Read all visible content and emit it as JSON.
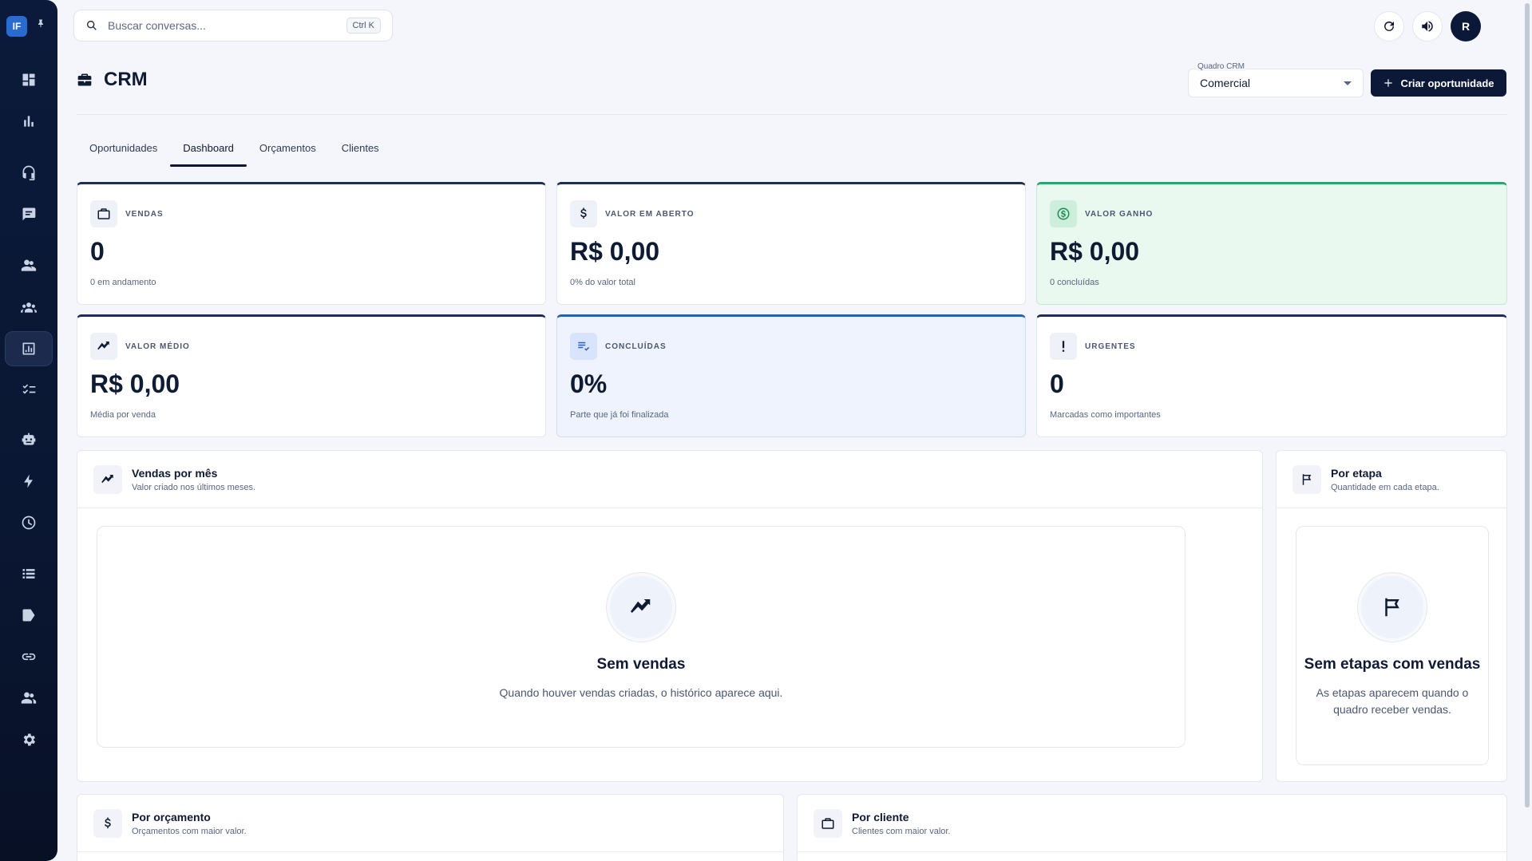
{
  "sidebar": {
    "logo_text": "IF",
    "items": [
      {
        "name": "dashboard-icon"
      },
      {
        "name": "bar-chart-icon"
      },
      {
        "name": "headset-icon"
      },
      {
        "name": "chat-icon"
      },
      {
        "name": "people-icon"
      },
      {
        "name": "groups-icon"
      },
      {
        "name": "analytics-icon",
        "active": true
      },
      {
        "name": "checklist-icon"
      },
      {
        "name": "robot-icon"
      },
      {
        "name": "bolt-icon"
      },
      {
        "name": "clock-icon"
      },
      {
        "name": "list-icon"
      },
      {
        "name": "tag-icon"
      },
      {
        "name": "link-icon"
      },
      {
        "name": "contacts-icon"
      },
      {
        "name": "settings-icon"
      }
    ]
  },
  "search": {
    "placeholder": "Buscar conversas...",
    "shortcut": "Ctrl K"
  },
  "header": {
    "avatar_initial": "R",
    "title": "CRM",
    "board_label": "Quadro CRM",
    "board_value": "Comercial",
    "create_label": "Criar oportunidade"
  },
  "tabs": [
    {
      "label": "Oportunidades"
    },
    {
      "label": "Dashboard",
      "active": true
    },
    {
      "label": "Orçamentos"
    },
    {
      "label": "Clientes"
    }
  ],
  "stats": [
    {
      "label": "VENDAS",
      "value": "0",
      "sub": "0 em andamento",
      "icon": "briefcase-icon",
      "variant": "default"
    },
    {
      "label": "VALOR EM ABERTO",
      "value": "R$ 0,00",
      "sub": "0% do valor total",
      "icon": "dollar-icon",
      "variant": "default"
    },
    {
      "label": "VALOR GANHO",
      "value": "R$ 0,00",
      "sub": "0 concluídas",
      "icon": "coin-icon",
      "variant": "green"
    },
    {
      "label": "VALOR MÉDIO",
      "value": "R$ 0,00",
      "sub": "Média por venda",
      "icon": "trend-icon",
      "variant": "default"
    },
    {
      "label": "CONCLUÍDAS",
      "value": "0%",
      "sub": "Parte que já foi finalizada",
      "icon": "list-check-icon",
      "variant": "blue"
    },
    {
      "label": "URGENTES",
      "value": "0",
      "sub": "Marcadas como importantes",
      "icon": "exclamation-icon",
      "variant": "default"
    }
  ],
  "panels": {
    "monthly": {
      "title": "Vendas por mês",
      "subtitle": "Valor criado nos últimos meses.",
      "empty_title": "Sem vendas",
      "empty_text": "Quando houver vendas criadas, o histórico aparece aqui."
    },
    "stage": {
      "title": "Por etapa",
      "subtitle": "Quantidade em cada etapa.",
      "empty_title": "Sem etapas com vendas",
      "empty_text": "As etapas aparecem quando o quadro receber vendas."
    },
    "budget": {
      "title": "Por orçamento",
      "subtitle": "Orçamentos com maior valor."
    },
    "client": {
      "title": "Por cliente",
      "subtitle": "Clientes com maior valor."
    }
  }
}
